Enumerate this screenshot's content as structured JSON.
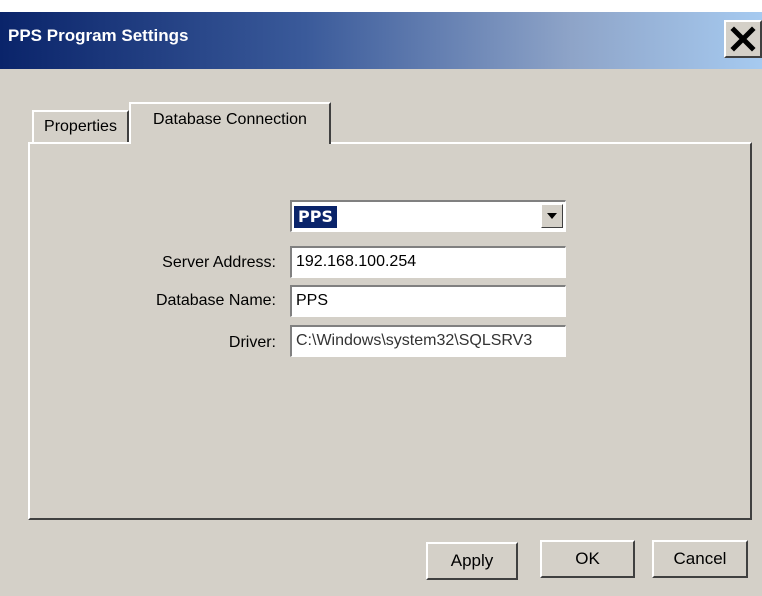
{
  "window": {
    "title": "PPS Program Settings"
  },
  "tabs": [
    {
      "label": "Properties",
      "active": false
    },
    {
      "label": "Database Connection",
      "active": true
    }
  ],
  "database": {
    "connection_select": "PPS",
    "server_address_label": "Server Address:",
    "server_address_value": "192.168.100.254",
    "database_name_label": "Database Name:",
    "database_name_value": "PPS",
    "driver_label": "Driver:",
    "driver_value": "C:\\Windows\\system32\\SQLSRV3"
  },
  "buttons": {
    "apply": "Apply",
    "ok": "OK",
    "cancel": "Cancel"
  },
  "icons": {
    "close": "close-icon",
    "dropdown": "chevron-down-icon"
  },
  "colors": {
    "title_start": "#0a246a",
    "title_end": "#a6caf0",
    "face": "#d4d0c8",
    "selection": "#0a246a"
  }
}
